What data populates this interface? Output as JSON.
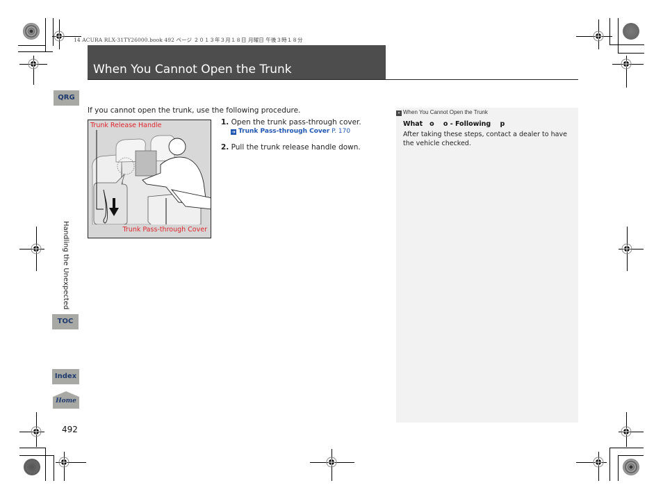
{
  "print_header": "14 ACURA RLX-31TY26000.book  492 ページ  ２０１３年３月１８日  月曜日  午後３時１８分",
  "title": "When You Cannot Open the Trunk",
  "nav": {
    "qrg": "QRG",
    "toc": "TOC",
    "index": "Index",
    "home": "Home"
  },
  "section_label": "Handling the Unexpected",
  "page_number": "492",
  "intro": "If you cannot open the trunk, use the following procedure.",
  "figure": {
    "label_top": "Trunk Release Handle",
    "label_bottom": "Trunk Pass-through Cover"
  },
  "steps": [
    {
      "number": "1.",
      "text": " Open the trunk pass-through cover.",
      "xref": {
        "icon": "arrow-right-icon",
        "title": "Trunk Pass-through Cover",
        "page": " P. 170"
      }
    },
    {
      "number": "2.",
      "text": " Pull the trunk release handle down."
    }
  ],
  "note": {
    "header_icon": "double-chevron-icon",
    "header": "When You Cannot Open the Trunk",
    "title": "What   o    o - Following    p",
    "body": "After taking these steps, contact a dealer to have the vehicle checked."
  }
}
